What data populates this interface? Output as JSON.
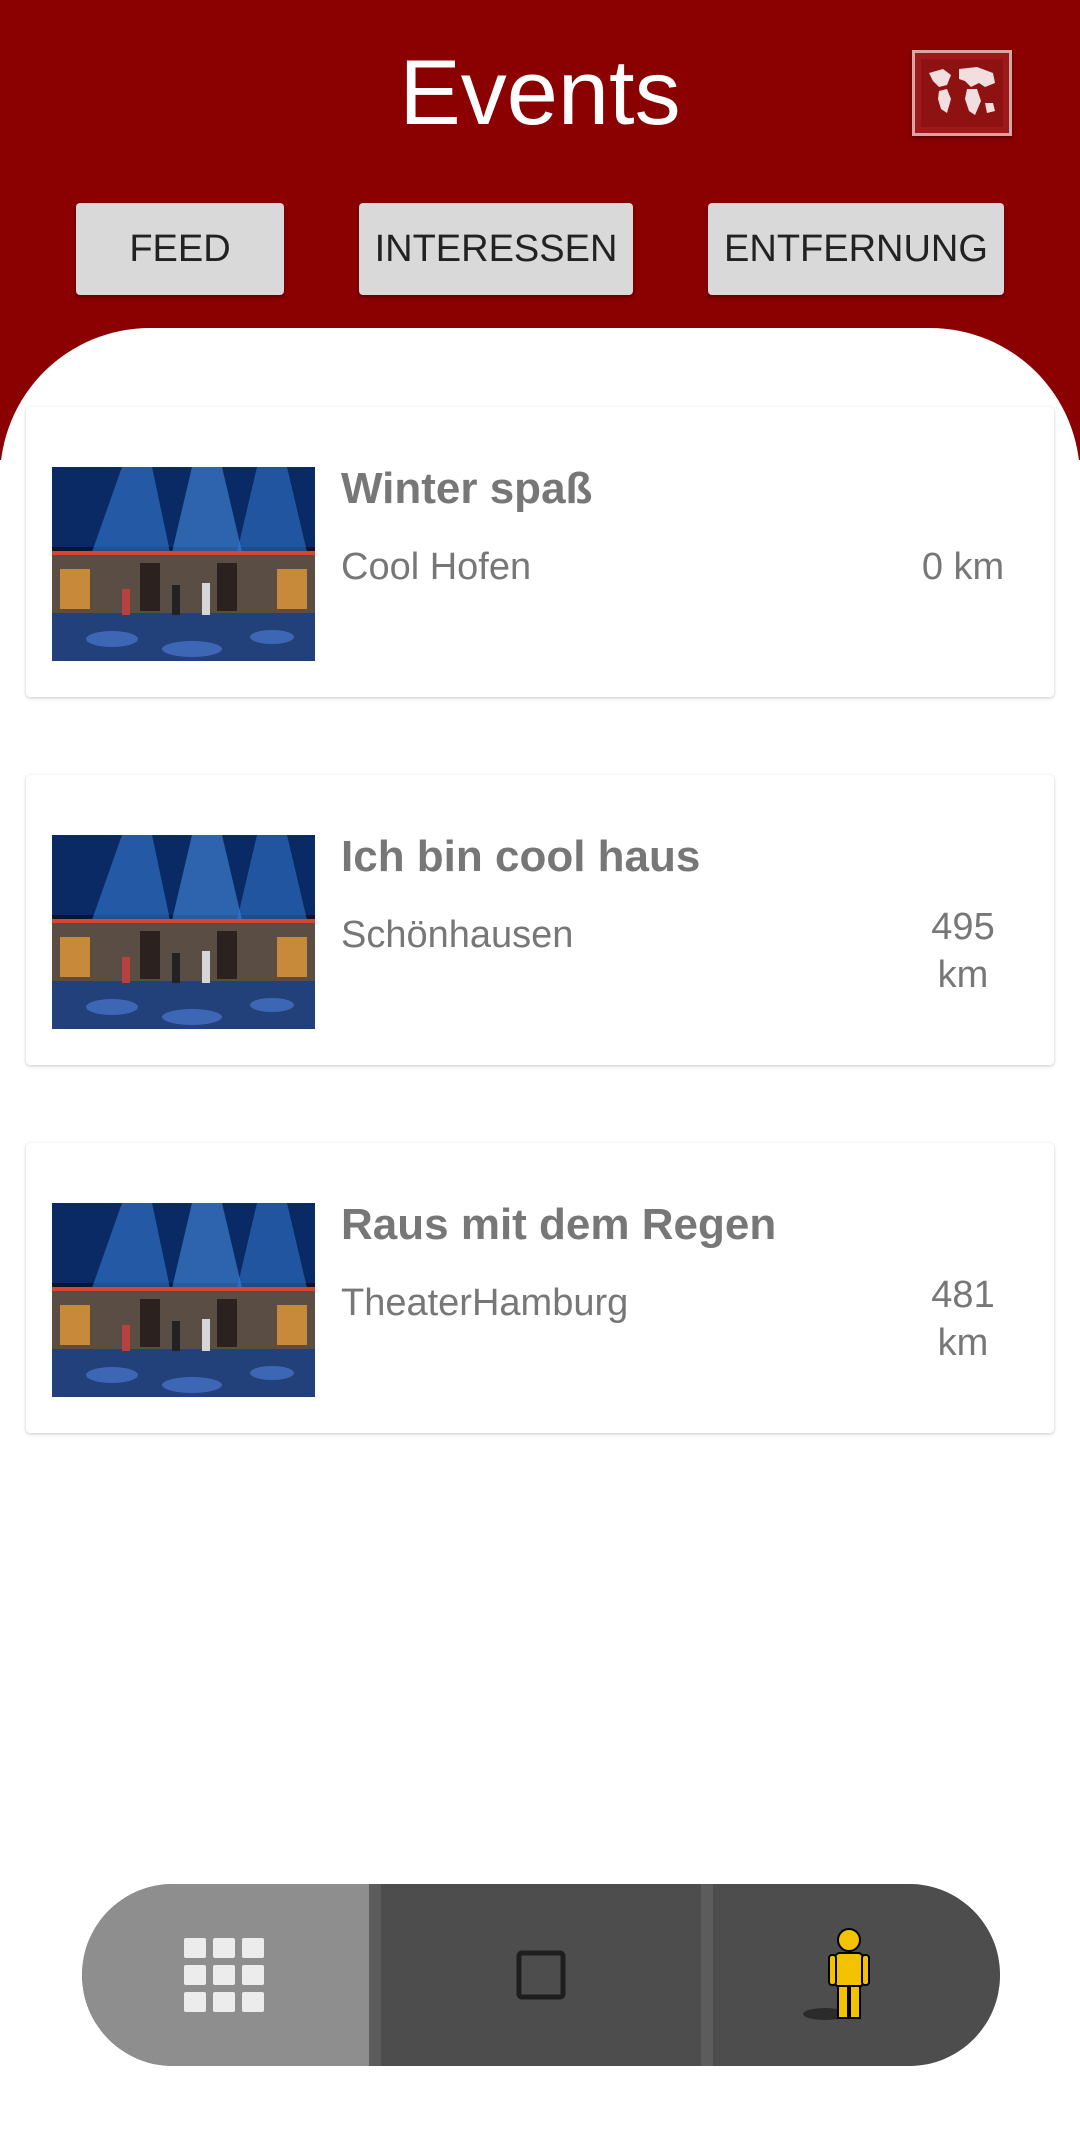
{
  "header": {
    "title": "Events",
    "map_icon": "world-map-icon",
    "color": "#8b0000"
  },
  "tabs": [
    {
      "label": "FEED"
    },
    {
      "label": "INTERESSEN"
    },
    {
      "label": "ENTFERNUNG"
    }
  ],
  "events": [
    {
      "title": "Winter spaß",
      "venue": "Cool Hofen",
      "distance": "0 km"
    },
    {
      "title": "Ich bin cool haus",
      "venue": "Schönhausen",
      "distance": "495 km"
    },
    {
      "title": "Raus mit dem Regen",
      "venue": "TheaterHamburg",
      "distance": "481 km"
    }
  ],
  "bottom_nav": [
    {
      "icon": "grid-icon",
      "active": true
    },
    {
      "icon": "square-icon",
      "active": false
    },
    {
      "icon": "person-icon",
      "active": false
    }
  ]
}
